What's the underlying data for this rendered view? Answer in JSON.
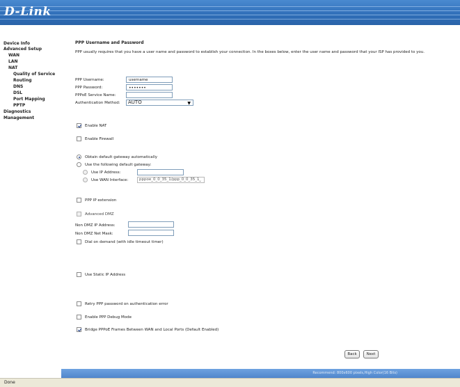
{
  "brand": {
    "logo": "D-Link"
  },
  "sidebar": {
    "items": [
      {
        "label": "Device Info"
      },
      {
        "label": "Advanced Setup"
      },
      {
        "label": "WAN"
      },
      {
        "label": "LAN"
      },
      {
        "label": "NAT"
      },
      {
        "label": "Quality of Service"
      },
      {
        "label": "Routing"
      },
      {
        "label": "DNS"
      },
      {
        "label": "DSL"
      },
      {
        "label": "Port Mapping"
      },
      {
        "label": "PPTP"
      },
      {
        "label": "Diagnostics"
      },
      {
        "label": "Management"
      }
    ]
  },
  "main": {
    "title": "PPP Username and Password",
    "description": "PPP usually requires that you have a user name and password to establish your connection. In the boxes below, enter the user name and password that your ISP has provided to you.",
    "fields": {
      "username_label": "PPP Username:",
      "username_value": "username",
      "password_label": "PPP Password:",
      "password_value": "•••••••",
      "service_label": "PPPoE Service Name:",
      "service_value": "",
      "auth_label": "Authentication Method:",
      "auth_value": "AUTO"
    },
    "enable_nat": {
      "label": "Enable NAT",
      "checked": true
    },
    "enable_firewall": {
      "label": "Enable Firewall",
      "checked": false
    },
    "gateway": {
      "auto_label": "Obtain default gateway automatically",
      "manual_label": "Use the following default gateway:",
      "ip_label": "Use IP Address:",
      "ip_value": "",
      "wan_label": "Use WAN Interface:",
      "wan_value": "pppoe_0_0_35_1/ppp_0_0_35_1"
    },
    "ppp_ip_extension": {
      "label": "PPP IP extension"
    },
    "advanced_dmz": {
      "label": "Advanced DMZ"
    },
    "dmz": {
      "ip_label": "Non DMZ IP Address:",
      "ip_value": "",
      "mask_label": "Non DMZ Net Mask:",
      "mask_value": ""
    },
    "dial_on_demand": {
      "label": "Dial on demand (with idle timeout timer)"
    },
    "static_ip": {
      "label": "Use Static IP Address"
    },
    "retry_ppp": {
      "label": "Retry PPP password on authentication error"
    },
    "debug_mode": {
      "label": "Enable PPP Debug Mode"
    },
    "bridge_pppoe": {
      "label": "Bridge PPPoE Frames Between WAN and Local Ports (Default Enabled)",
      "checked": true
    },
    "back_button": "Back",
    "next_button": "Next"
  },
  "footer": {
    "recommend": "Recommend: 800x600 pixels,High Color(16 Bits)"
  },
  "statusbar": {
    "text": "Done"
  },
  "colors": {
    "header_blue": "#2f6eb8",
    "footer_blue": "#5a8fd2",
    "status_bg": "#ece9d8"
  }
}
